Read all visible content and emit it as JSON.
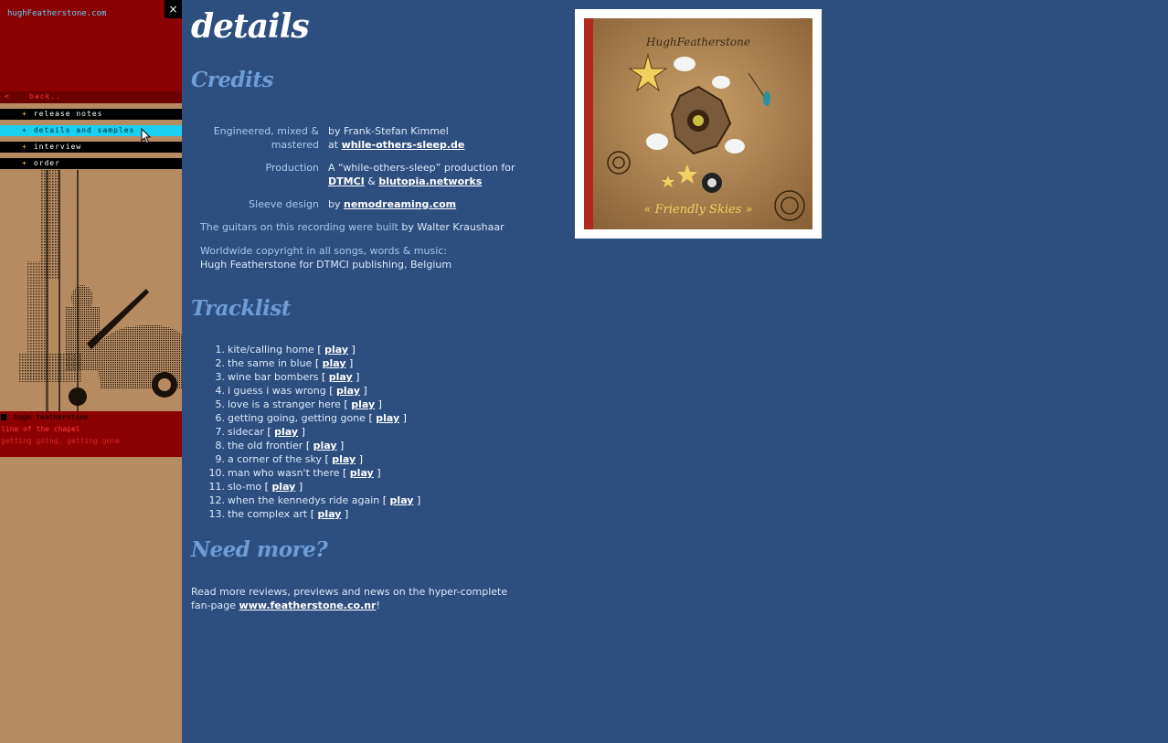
{
  "sidebar": {
    "site_link": "hughFeatherstone.com",
    "close": "×",
    "menu": [
      {
        "prefix": "<",
        "label": "back.."
      },
      {
        "prefix": "+",
        "label": "release notes"
      },
      {
        "prefix": "+",
        "label": "details and samples"
      },
      {
        "prefix": "+",
        "label": "interview"
      },
      {
        "prefix": "+",
        "label": "order"
      }
    ],
    "artist": "hugh featherstone",
    "track_line1": "line of the chapel",
    "track_line2": "getting going, getting gone"
  },
  "main": {
    "title": "details",
    "credits_heading": "Credits",
    "credits": {
      "engineered_label": "Engineered, mixed & mastered",
      "engineered_by": "by Frank-Stefan Kimmel",
      "engineered_at_prefix": "at",
      "engineered_at_link": "while-others-sleep.de",
      "production_label": "Production",
      "production_text": "A “while-others-sleep” production for",
      "production_link1": "DTMCI",
      "production_amp": "&",
      "production_link2": "blutopia.networks",
      "sleeve_label": "Sleeve design",
      "sleeve_by": "by",
      "sleeve_link": "nemodreaming.com",
      "guitars_text": "The guitars on this recording were built",
      "guitars_by": "by Walter Kraushaar",
      "copyright_text": "Worldwide copyright in all songs, words & music:",
      "copyright_holder": "Hugh Featherstone for DTMCI publishing, Belgium"
    },
    "tracklist_heading": "Tracklist",
    "play_label": "play",
    "tracks": [
      {
        "num": "1.",
        "name": "kite/calling home"
      },
      {
        "num": "2.",
        "name": "the same in blue"
      },
      {
        "num": "3.",
        "name": "wine bar bombers"
      },
      {
        "num": "4.",
        "name": "i guess i was wrong"
      },
      {
        "num": "5.",
        "name": "love is a stranger here"
      },
      {
        "num": "6.",
        "name": "getting going, getting gone"
      },
      {
        "num": "7.",
        "name": "sidecar"
      },
      {
        "num": "8.",
        "name": "the old frontier"
      },
      {
        "num": "9.",
        "name": "a corner of the sky"
      },
      {
        "num": "10.",
        "name": "man who wasn't there"
      },
      {
        "num": "11.",
        "name": "slo-mo"
      },
      {
        "num": "12.",
        "name": "when the kennedys ride again"
      },
      {
        "num": "13.",
        "name": "the complex art"
      }
    ],
    "needmore_heading": "Need more?",
    "needmore_text": "Read more reviews, previews and news on the hyper-complete fan-page",
    "needmore_link": "www.featherstone.co.nr",
    "needmore_end": "!"
  },
  "cover": {
    "artist_text": "HughFeatherstone",
    "album_text": "« Friendly Skies »"
  }
}
